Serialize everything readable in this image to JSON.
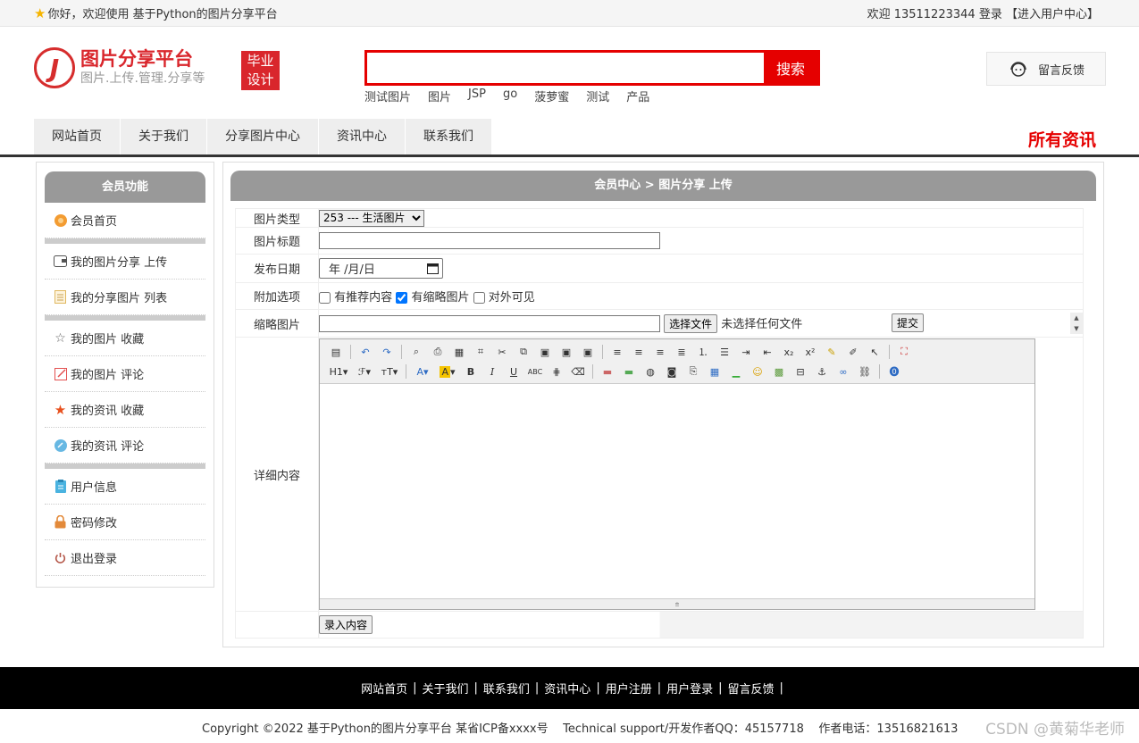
{
  "topbar": {
    "welcome": "你好，欢迎使用 基于Python的图片分享平台",
    "user_prefix": "欢迎 ",
    "phone": "13511223344",
    "login": "登录",
    "user_center": "【进入用户中心】"
  },
  "logo": {
    "mark": "J",
    "title": "图片分享平台",
    "subtitle": "图片.上传.管理.分享等"
  },
  "badge": {
    "line1": "毕业",
    "line2": "设计"
  },
  "search": {
    "value": "",
    "button": "搜索"
  },
  "hotwords": [
    "测试图片",
    "图片",
    "JSP",
    "go",
    "菠萝蜜",
    "测试",
    "产品"
  ],
  "feedback": {
    "label": "留言反馈"
  },
  "nav": {
    "items": [
      "网站首页",
      "关于我们",
      "分享图片中心",
      "资讯中心",
      "联系我们"
    ],
    "all_news": "所有资讯"
  },
  "sidebar": {
    "title": "会员功能",
    "groups": [
      [
        {
          "label": "会员首页",
          "icon": "home-icon"
        }
      ],
      [
        {
          "label": "我的图片分享 上传",
          "icon": "upload-icon"
        },
        {
          "label": "我的分享图片 列表",
          "icon": "list-icon"
        }
      ],
      [
        {
          "label": "我的图片 收藏",
          "icon": "star-outline-icon"
        },
        {
          "label": "我的图片 评论",
          "icon": "edit-icon"
        },
        {
          "label": "我的资讯 收藏",
          "icon": "star-filled-icon"
        },
        {
          "label": "我的资讯 评论",
          "icon": "comment-icon"
        }
      ],
      [
        {
          "label": "用户信息",
          "icon": "clipboard-icon"
        },
        {
          "label": "密码修改",
          "icon": "lock-icon"
        },
        {
          "label": "退出登录",
          "icon": "power-icon"
        }
      ]
    ]
  },
  "main": {
    "breadcrumb": "会员中心 > 图片分享 上传",
    "form": {
      "type_label": "图片类型",
      "type_selected": "253 --- 生活图片",
      "title_label": "图片标题",
      "title_value": "",
      "date_label": "发布日期",
      "date_value": "年 /月/日",
      "options_label": "附加选项",
      "opt1": "有推荐内容",
      "opt1_checked": false,
      "opt2": "有缩略图片",
      "opt2_checked": true,
      "opt3": "对外可见",
      "opt3_checked": false,
      "thumb_label": "缩略图片",
      "choose_file": "选择文件",
      "no_file": "未选择任何文件",
      "submit": "提交",
      "content_label": "详细内容",
      "save_button": "录入内容"
    }
  },
  "footer": {
    "links": [
      "网站首页",
      "关于我们",
      "联系我们",
      "资讯中心",
      "用户注册",
      "用户登录",
      "留言反馈"
    ],
    "separator": "|",
    "copyright": "Copyright ©2022 基于Python的图片分享平台 某省ICP备xxxx号    Technical support/开发作者QQ：45157718    作者电话：13516821613",
    "watermark": "CSDN @黄菊华老师"
  },
  "colors": {
    "accent": "#e50000",
    "brand": "#d9262c",
    "panel_head": "#999999"
  }
}
